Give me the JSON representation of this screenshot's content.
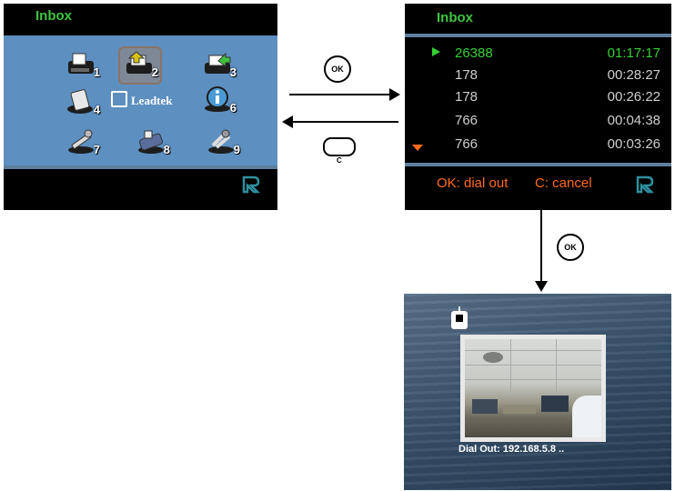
{
  "menu_screen": {
    "title": "Inbox",
    "brand": "Leadtek",
    "items": [
      {
        "number": "1",
        "icon": "fax-machine-icon"
      },
      {
        "number": "2",
        "icon": "inbox-icon",
        "selected": true
      },
      {
        "number": "3",
        "icon": "outbox-icon"
      },
      {
        "number": "4",
        "icon": "phonebook-icon"
      },
      {
        "number": "6",
        "icon": "info-icon"
      },
      {
        "number": "7",
        "icon": "tools-icon"
      },
      {
        "number": "8",
        "icon": "camera-phone-icon"
      },
      {
        "number": "9",
        "icon": "settings-icon"
      }
    ]
  },
  "inbox_screen": {
    "title": "Inbox",
    "rows": [
      {
        "number": "26388",
        "time": "01:17:17",
        "active": true
      },
      {
        "number": "178",
        "time": "00:28:27"
      },
      {
        "number": "178",
        "time": "00:26:22"
      },
      {
        "number": "766",
        "time": "00:04:38"
      },
      {
        "number": "766",
        "time": "00:03:26"
      }
    ],
    "hint_ok": "OK: dial out",
    "hint_cancel": "C: cancel"
  },
  "dial_screen": {
    "caption": "Dial Out: 192.168.5.8 .."
  },
  "keys": {
    "ok_forward": "OK",
    "c_back": "C",
    "ok_down": "OK"
  },
  "colors": {
    "title_green": "#3fc63f",
    "hint_orange": "#ff6a1a",
    "logo_teal": "#2e8f9f"
  }
}
